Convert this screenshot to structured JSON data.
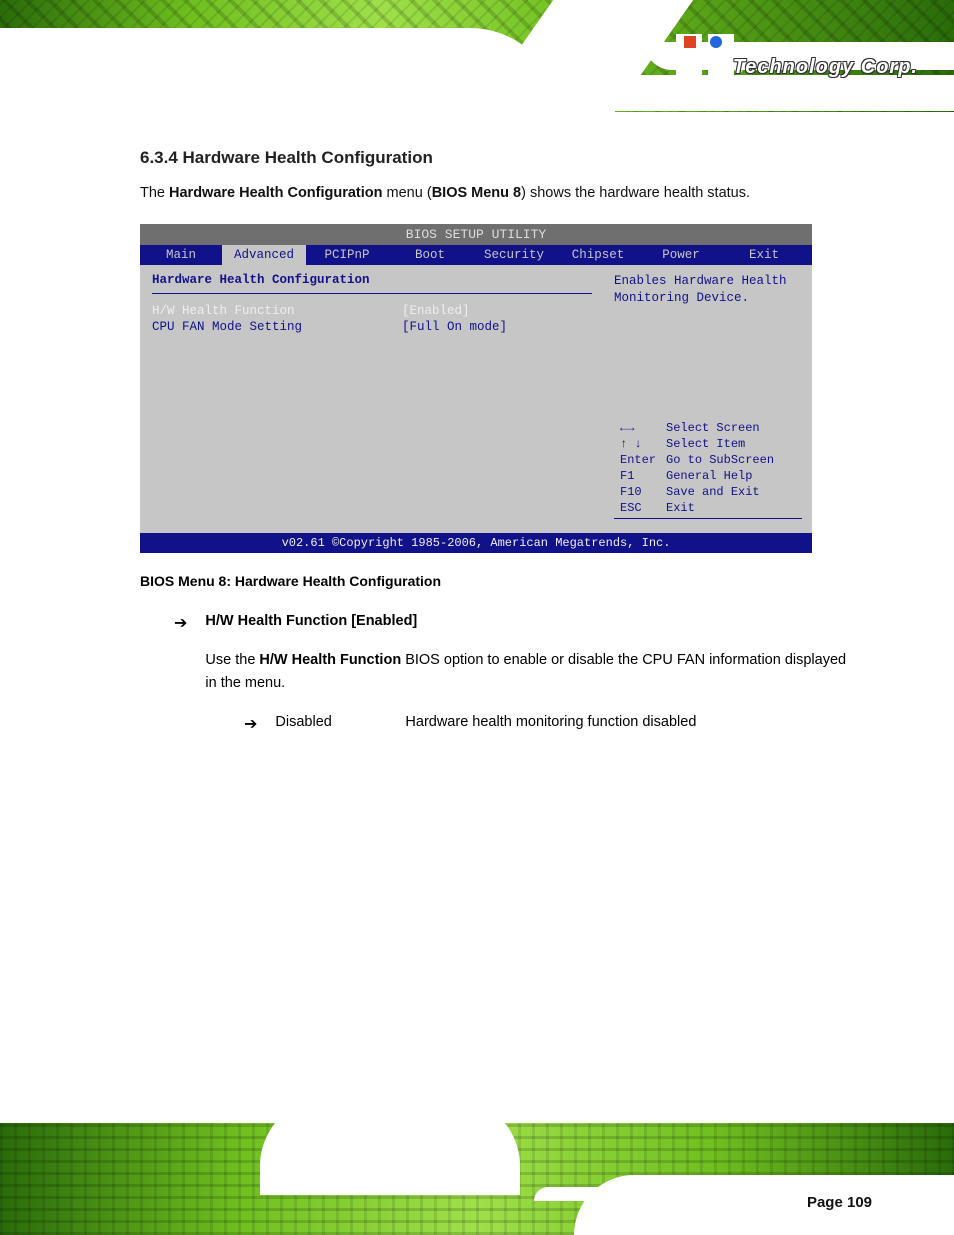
{
  "brand": {
    "reg": "®",
    "corp": "Technology Corp."
  },
  "section": {
    "number": "6.3.4",
    "title": "Hardware Health Configuration",
    "fullTitle": "6.3.4 Hardware Health Configuration",
    "intro": "The Hardware Health Configuration menu (BIOS Menu 8) shows the hardware health status."
  },
  "bios": {
    "utilityTitle": "BIOS SETUP UTILITY",
    "menus": [
      "Main",
      "Advanced",
      "PCIPnP",
      "Boot",
      "Security",
      "Chipset",
      "Power",
      "Exit"
    ],
    "activeMenuIndex": 1,
    "menuWidths": [
      "82px",
      "84px",
      "82px",
      "84px",
      "84px",
      "84px",
      "82px",
      "84px"
    ],
    "left": {
      "heading": "Hardware Health Configuration",
      "item1Name": "H/W Health Function",
      "item1Value": "[Enabled]",
      "item2Name": "CPU FAN Mode Setting",
      "item2Value": "[Full On mode]"
    },
    "right": {
      "topHint": "Enables Hardware Health Monitoring Device.",
      "keys": [
        {
          "k": "←→",
          "v": "Select Screen"
        },
        {
          "k": "↑ ↓",
          "v": "Select Item"
        },
        {
          "k": "Enter",
          "v": "Go to SubScreen"
        },
        {
          "k": "F1",
          "v": "General Help"
        },
        {
          "k": "F10",
          "v": "Save and Exit"
        },
        {
          "k": "ESC",
          "v": "Exit"
        }
      ]
    },
    "footer": "v02.61 ©Copyright 1985-2006, American Megatrends, Inc."
  },
  "caption": "BIOS Menu 8: Hardware Health Configuration",
  "option": {
    "title": "H/W Health Function [Enabled]",
    "desc": "Use the H/W Health Function BIOS option to enable or disable the CPU FAN information displayed in the menu.",
    "subs": [
      {
        "name": "Disabled",
        "default": "",
        "desc": "Hardware health monitoring function disabled"
      }
    ]
  },
  "pagefoot": {
    "label": "",
    "number": "Page 109"
  }
}
